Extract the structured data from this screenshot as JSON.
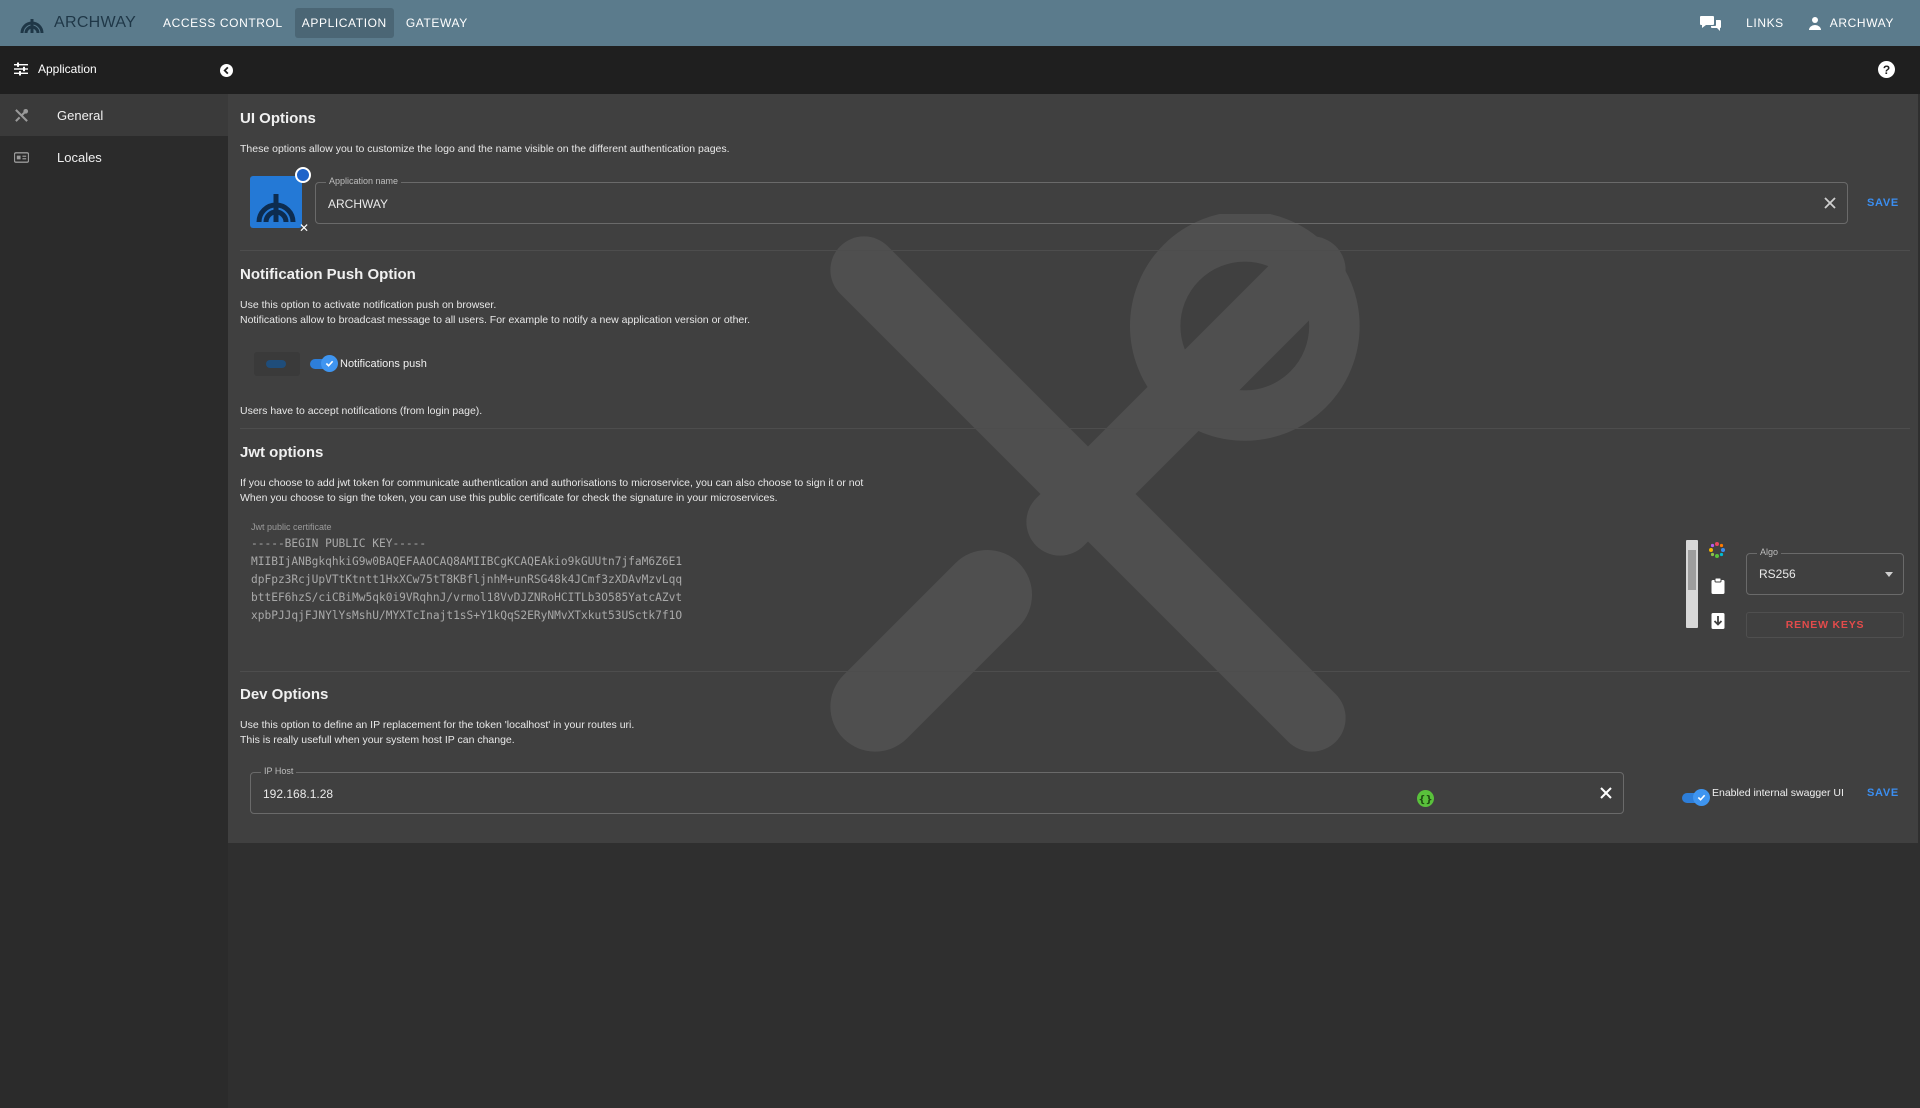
{
  "header": {
    "brand": "ARCHWAY",
    "nav": [
      "ACCESS CONTROL",
      "APPLICATION",
      "GATEWAY"
    ],
    "active_nav": "APPLICATION",
    "links": "LINKS",
    "user": "ARCHWAY"
  },
  "subheader": {
    "title": "Application",
    "help": "?"
  },
  "sidebar": {
    "items": [
      {
        "label": "General",
        "icon": "tools-icon"
      },
      {
        "label": "Locales",
        "icon": "locale-icon"
      }
    ]
  },
  "ui_options": {
    "title": "UI Options",
    "desc": "These options allow you to customize the logo and the name visible on the different authentication pages.",
    "app_name_label": "Application name",
    "app_name_value": "ARCHWAY",
    "save": "SAVE"
  },
  "notification": {
    "title": "Notification Push Option",
    "desc1": "Use this option to activate notification push on browser.",
    "desc2": "Notifications allow to broadcast message to all users. For example to notify a new application version or other.",
    "switch_label": "Notifications push",
    "enabled": true,
    "note": "Users have to accept notifications (from login page)."
  },
  "jwt": {
    "title": "Jwt options",
    "desc1": "If you choose to add jwt token for communicate authentication and authorisations to microservice, you can also choose to sign it or not",
    "desc2": "When you choose to sign the token, you can use this public certificate for check the signature in your microservices.",
    "cert_label": "Jwt public certificate",
    "cert_lines": [
      "-----BEGIN PUBLIC KEY-----",
      "MIIBIjANBgkqhkiG9w0BAQEFAAOCAQ8AMIIBCgKCAQEAkio9kGUUtn7jfaM6Z6E1",
      "dpFpz3RcjUpVTtKtntt1HxXCw75tT8KBfljnhM+unRSG48k4JCmf3zXDAvMzvLqq",
      "bttEF6hzS/ciCBiMw5qk0i9VRqhnJ/vrmol18VvDJZNRoHCITLb3O585YatcAZvt",
      "xpbPJJqjFJNYlYsMshU/MYXTcInajt1sS+Y1kQqS2ERyNMvXTxkut53USctk7f1O"
    ],
    "algo_label": "Algo",
    "algo_value": "RS256",
    "renew": "RENEW KEYS"
  },
  "dev": {
    "title": "Dev Options",
    "desc1": "Use this option to define an IP replacement for the token 'localhost' in your routes uri.",
    "desc2": "This is really usefull when your system host IP can change.",
    "ip_label": "IP Host",
    "ip_value": "192.168.1.28",
    "swagger_label": "Enabled internal swagger UI",
    "swagger_enabled": true,
    "save": "SAVE"
  },
  "colors": {
    "topbar": "#5b7b8c",
    "accent": "#3b8ef0",
    "danger": "#e34b4b",
    "swagger": "#59c13b"
  }
}
